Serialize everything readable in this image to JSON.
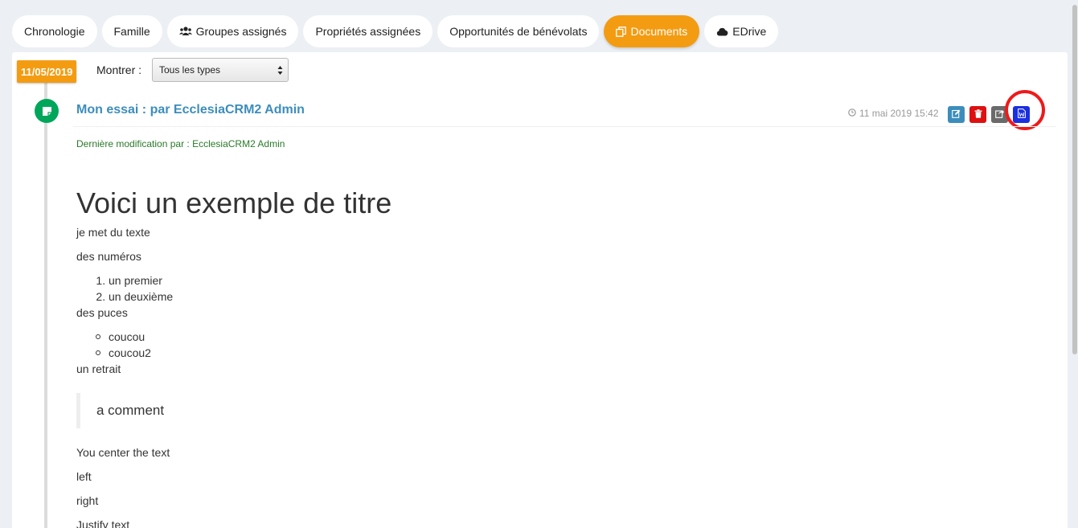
{
  "tabs": [
    {
      "label": "Chronologie",
      "icon": ""
    },
    {
      "label": "Famille",
      "icon": ""
    },
    {
      "label": "Groupes assignés",
      "icon": "users-icon"
    },
    {
      "label": "Propriétés assignées",
      "icon": ""
    },
    {
      "label": "Opportunités de bénévolats",
      "icon": ""
    },
    {
      "label": "Documents",
      "icon": "copy-icon",
      "active": true
    },
    {
      "label": "EDrive",
      "icon": "cloud-icon"
    }
  ],
  "timeline": {
    "date": "11/05/2019",
    "filter_label": "Montrer :",
    "filter_value": "Tous les types"
  },
  "item": {
    "title": "Mon essai : par EcclesiaCRM2 Admin",
    "time": "11 mai 2019 15:42",
    "modified": "Dernière modification par : EcclesiaCRM2 Admin",
    "actions": [
      "edit-icon",
      "trash-icon",
      "share-icon",
      "word-icon"
    ]
  },
  "document": {
    "heading": "Voici un exemple de titre",
    "p1": "je met du texte",
    "p2": "des numéros",
    "ordered": [
      "un premier",
      "un deuxième"
    ],
    "p3": "des puces",
    "bullets": [
      "coucou",
      "coucou2"
    ],
    "p4": "un retrait",
    "quote": "a comment",
    "p5": "You center the text",
    "p6": "left",
    "p7": "right",
    "p8": "Justify text"
  },
  "colors": {
    "accent": "#f39c12",
    "link": "#3c8dbc",
    "bubble": "#00a65a",
    "highlight": "#ee1a1a"
  }
}
